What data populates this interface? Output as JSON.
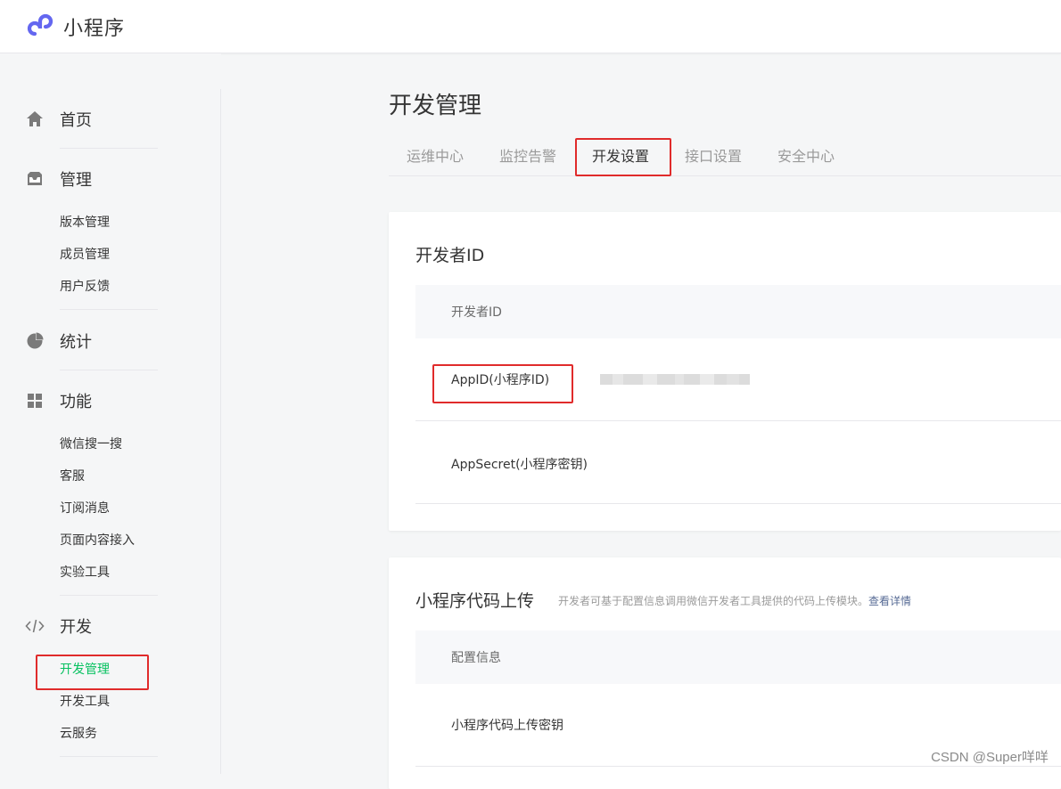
{
  "header": {
    "app_title": "小程序"
  },
  "sidebar": {
    "groups": [
      {
        "title": "首页",
        "icon": "home-icon",
        "items": []
      },
      {
        "title": "管理",
        "icon": "inbox-icon",
        "items": [
          "版本管理",
          "成员管理",
          "用户反馈"
        ]
      },
      {
        "title": "统计",
        "icon": "pie-chart-icon",
        "items": []
      },
      {
        "title": "功能",
        "icon": "grid-icon",
        "items": [
          "微信搜一搜",
          "客服",
          "订阅消息",
          "页面内容接入",
          "实验工具"
        ]
      },
      {
        "title": "开发",
        "icon": "code-icon",
        "items": [
          "开发管理",
          "开发工具",
          "云服务"
        ]
      }
    ],
    "active_item": "开发管理"
  },
  "main": {
    "page_title": "开发管理",
    "tabs": [
      "运维中心",
      "监控告警",
      "开发设置",
      "接口设置",
      "安全中心"
    ],
    "active_tab": "开发设置",
    "developer_id_card": {
      "title": "开发者ID",
      "table_header": "开发者ID",
      "rows": [
        {
          "label": "AppID(小程序ID)"
        },
        {
          "label": "AppSecret(小程序密钥)"
        }
      ]
    },
    "upload_card": {
      "title": "小程序代码上传",
      "description": "开发者可基于配置信息调用微信开发者工具提供的代码上传模块。",
      "link": "查看详情",
      "table_header": "配置信息",
      "rows": [
        {
          "label": "小程序代码上传密钥"
        }
      ]
    }
  },
  "watermark": "CSDN @Super咩咩",
  "colors": {
    "accent_green": "#07c160",
    "highlight_red": "#e02b2b",
    "link_blue": "#576b95",
    "logo_purple": "#6467f0"
  }
}
